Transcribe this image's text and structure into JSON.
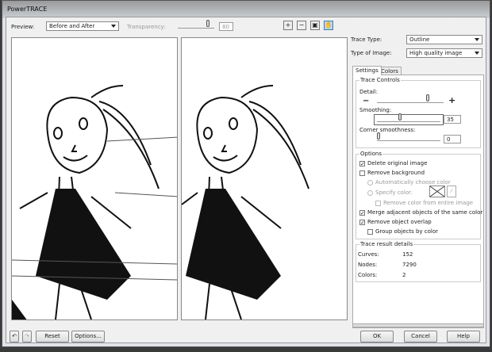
{
  "window": {
    "title": "PowerTRACE"
  },
  "preview": {
    "label": "Preview:",
    "value": "Before and After",
    "transparency_label": "Transparency:",
    "transparency_value": "80"
  },
  "tools": [
    "zoom-in-icon",
    "zoom-out-icon",
    "fit-icon",
    "pan-hand-icon"
  ],
  "right": {
    "trace_type_label": "Trace Type:",
    "trace_type_value": "Outline",
    "image_type_label": "Type of Image:",
    "image_type_value": "High quality image",
    "tabs": [
      "Settings",
      "Colors"
    ],
    "controls": {
      "title": "Trace Controls",
      "detail": "Detail:",
      "smoothing": "Smoothing:",
      "smoothing_value": "35",
      "corner": "Corner smoothness:",
      "corner_value": "0",
      "detail_level": 0.75,
      "smoothing_level": 0.35,
      "corner_level": 0
    },
    "options": {
      "title": "Options",
      "delete_original": {
        "label": "Delete original image",
        "checked": true
      },
      "remove_bg": {
        "label": "Remove background",
        "checked": false
      },
      "auto_color": "Automatically choose color",
      "specify_color": "Specify color:",
      "remove_entire": "Remove color from entire image",
      "merge": {
        "label": "Merge adjacent objects of the same color",
        "checked": true
      },
      "overlap": {
        "label": "Remove object overlap",
        "checked": true
      },
      "group": {
        "label": "Group objects by color",
        "checked": false
      }
    },
    "results": {
      "title": "Trace result details",
      "curves_label": "Curves:",
      "curves": "152",
      "nodes_label": "Nodes:",
      "nodes": "7290",
      "colors_label": "Colors:",
      "colors": "2"
    }
  },
  "buttons": {
    "reset": "Reset",
    "options": "Options...",
    "ok": "OK",
    "cancel": "Cancel",
    "help": "Help"
  }
}
